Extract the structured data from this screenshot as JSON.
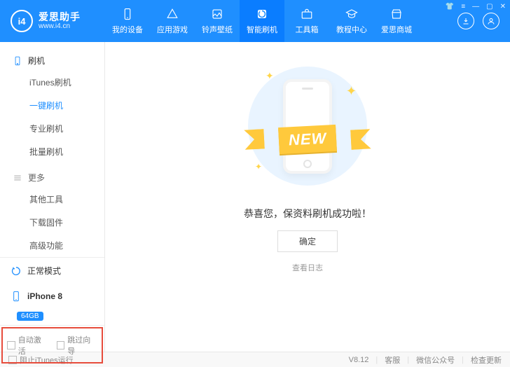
{
  "brand": {
    "logo_text": "i4",
    "name": "爱思助手",
    "url": "www.i4.cn"
  },
  "nav": [
    {
      "id": "device",
      "label": "我的设备"
    },
    {
      "id": "apps",
      "label": "应用游戏"
    },
    {
      "id": "ringwall",
      "label": "铃声壁纸"
    },
    {
      "id": "flash",
      "label": "智能刷机",
      "active": true
    },
    {
      "id": "tools",
      "label": "工具箱"
    },
    {
      "id": "tutorial",
      "label": "教程中心"
    },
    {
      "id": "store",
      "label": "爱思商城"
    }
  ],
  "sidebar": {
    "groups": [
      {
        "title": "刷机",
        "items": [
          "iTunes刷机",
          "一键刷机",
          "专业刷机",
          "批量刷机"
        ],
        "active_index": 1
      },
      {
        "title": "更多",
        "items": [
          "其他工具",
          "下载固件",
          "高级功能"
        ]
      }
    ],
    "mode": "正常模式",
    "device_name": "iPhone 8",
    "device_badge": "64GB",
    "footer_opts": [
      "自动激活",
      "跳过向导"
    ]
  },
  "main": {
    "ribbon": "NEW",
    "success_text": "恭喜您，保资料刷机成功啦！",
    "ok_button": "确定",
    "log_link": "查看日志"
  },
  "footer": {
    "block_itunes": "阻止iTunes运行",
    "version": "V8.12",
    "links": [
      "客服",
      "微信公众号",
      "检查更新"
    ]
  }
}
